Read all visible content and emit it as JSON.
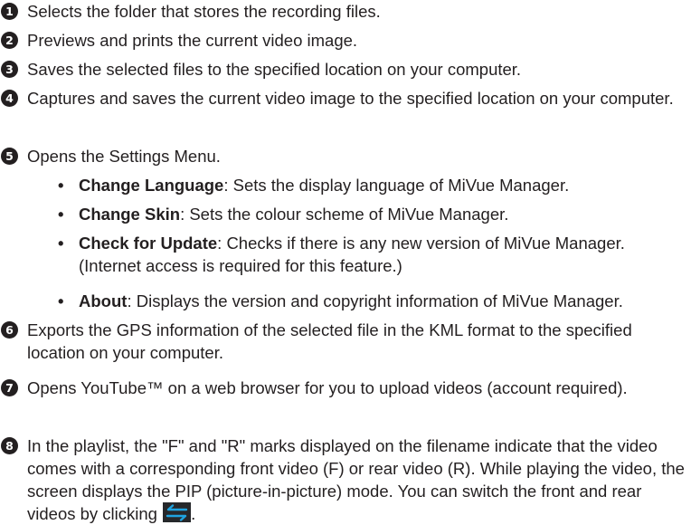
{
  "items": [
    {
      "num": "1",
      "text": "Selects the folder that stores the recording files."
    },
    {
      "num": "2",
      "text": "Previews and prints the current video image."
    },
    {
      "num": "3",
      "text": "Saves the selected files to the specified location on your computer."
    },
    {
      "num": "4",
      "text": "Captures and saves the current video image to the specified location on your computer."
    },
    {
      "num": "5",
      "text": "Opens the Settings Menu."
    },
    {
      "num": "6",
      "text": "Exports the GPS information of the selected file in the KML format to the specified location on your computer."
    },
    {
      "num": "7",
      "text": "Opens YouTube™ on a web browser for you to upload videos (account required)."
    },
    {
      "num": "8",
      "text": "In the playlist, the \"F\" and \"R\" marks displayed on the filename indicate that the video comes with a corresponding front video (F) or rear video (R). While playing the video, the screen displays the PIP (picture-in-picture) mode. You can switch the front and rear videos by clicking",
      "suffix": "."
    }
  ],
  "settings_menu": [
    {
      "title": "Change Language",
      "desc": ": Sets the display language of MiVue Manager."
    },
    {
      "title": "Change Skin",
      "desc": ": Sets the colour scheme of MiVue Manager."
    },
    {
      "title": "Check for Update",
      "desc": ": Checks if there is any new version of MiVue Manager. (Internet access is required for this feature.)"
    },
    {
      "title": "About",
      "desc": ": Displays the version and copyright information of MiVue Manager."
    }
  ],
  "bullet_char": "•",
  "icons": {
    "switch": "swap-arrows-icon"
  }
}
